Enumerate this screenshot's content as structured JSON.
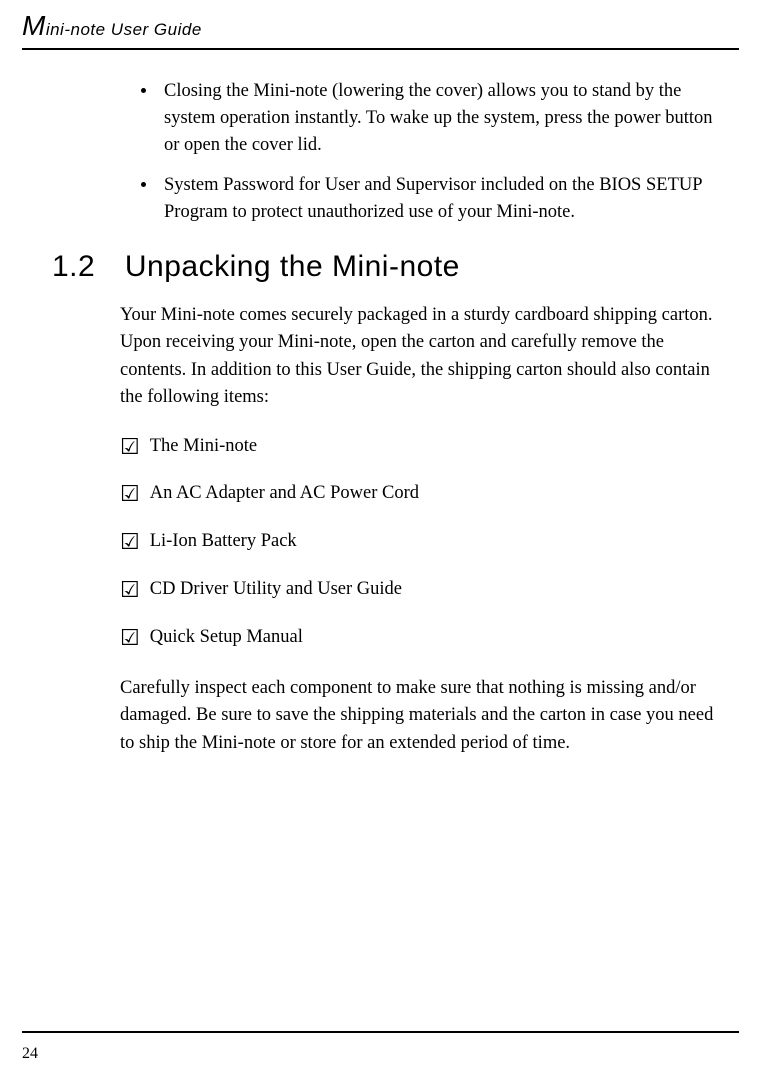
{
  "header": {
    "title_cap": "M",
    "title_rest": "ini-note User Guide"
  },
  "bullets": [
    "Closing the Mini-note (lowering the cover) allows you to stand by the system operation instantly. To wake up the system, press the power button or open the cover lid.",
    "System Password for User and Supervisor included on the BIOS SETUP Program to protect unauthorized use of your Mini-note."
  ],
  "section": {
    "number": "1.2",
    "title": "Unpacking the Mini-note"
  },
  "intro": "Your Mini-note comes securely packaged in a sturdy cardboard shipping carton. Upon receiving your Mini-note, open the carton and carefully remove the contents. In addition to this User Guide, the shipping carton should also contain the following items:",
  "checklist": [
    "The Mini-note",
    "An AC Adapter and AC Power Cord",
    "Li-Ion Battery Pack",
    "CD Driver Utility and User Guide",
    "Quick Setup Manual"
  ],
  "outro": "Carefully inspect each component to make sure that nothing is missing and/or damaged. Be sure to save the shipping materials and the carton in case you need to ship the Mini-note or store for an extended period of time.",
  "page_number": "24",
  "icons": {
    "checkbox": "☑"
  }
}
